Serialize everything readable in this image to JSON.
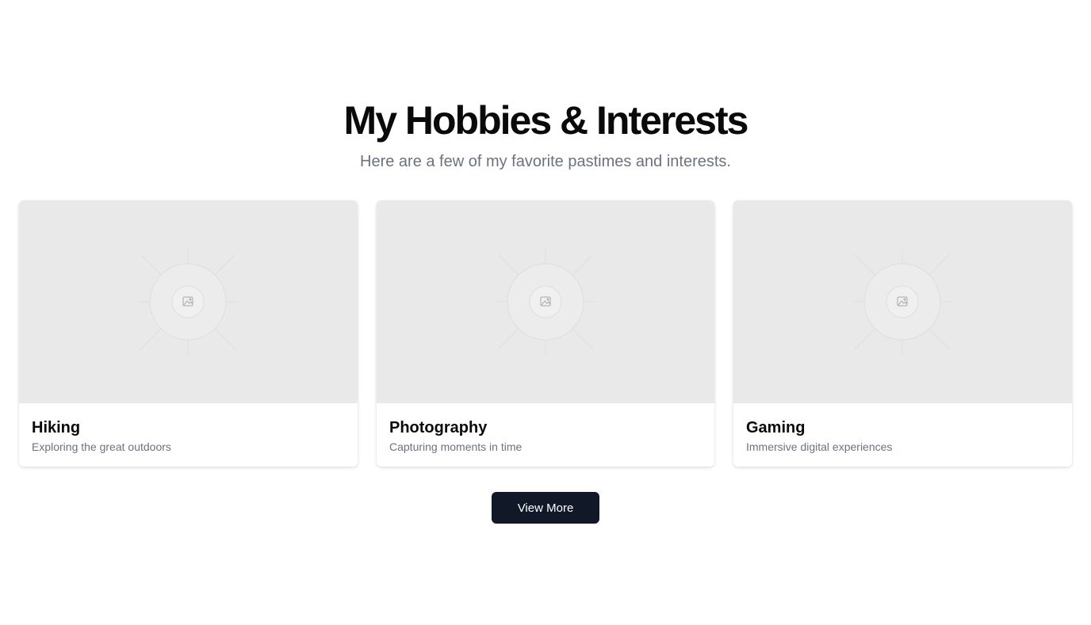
{
  "header": {
    "title": "My Hobbies & Interests",
    "subtitle": "Here are a few of my favorite pastimes and interests."
  },
  "cards": [
    {
      "title": "Hiking",
      "description": "Exploring the great outdoors",
      "image_icon": "image-placeholder-icon"
    },
    {
      "title": "Photography",
      "description": "Capturing moments in time",
      "image_icon": "image-placeholder-icon"
    },
    {
      "title": "Gaming",
      "description": "Immersive digital experiences",
      "image_icon": "image-placeholder-icon"
    }
  ],
  "actions": {
    "view_more_label": "View More"
  },
  "colors": {
    "button_bg": "#111827",
    "placeholder_bg": "#e9e9e9",
    "muted_text": "#6b7280"
  }
}
